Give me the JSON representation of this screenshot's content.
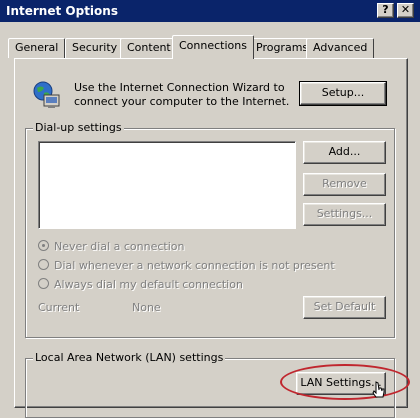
{
  "window": {
    "title": "Internet Options",
    "help_glyph": "?",
    "close_glyph": "✕"
  },
  "tabs": [
    {
      "label": "General",
      "active": false
    },
    {
      "label": "Security",
      "active": false
    },
    {
      "label": "Content",
      "active": false
    },
    {
      "label": "Connections",
      "active": true
    },
    {
      "label": "Programs",
      "active": false
    },
    {
      "label": "Advanced",
      "active": false
    }
  ],
  "wizard": {
    "line1": "Use the Internet Connection Wizard to",
    "line2": "connect your computer to the Internet.",
    "setup_label": "Setup..."
  },
  "dialup": {
    "legend": "Dial-up settings",
    "add_label": "Add...",
    "remove_label": "Remove",
    "settings_label": "Settings...",
    "options": [
      {
        "label": "Never dial a connection",
        "checked": true
      },
      {
        "label": "Dial whenever a network connection is not present",
        "checked": false
      },
      {
        "label": "Always dial my default connection",
        "checked": false
      }
    ],
    "current_label": "Current",
    "current_value": "None",
    "set_default_label": "Set Default"
  },
  "lan": {
    "legend": "Local Area Network (LAN) settings",
    "lan_settings_label": "LAN Settings..."
  },
  "colors": {
    "titlebar": "#0a246a",
    "face": "#d4d0c8",
    "highlight_annotation": "#c0262e"
  }
}
